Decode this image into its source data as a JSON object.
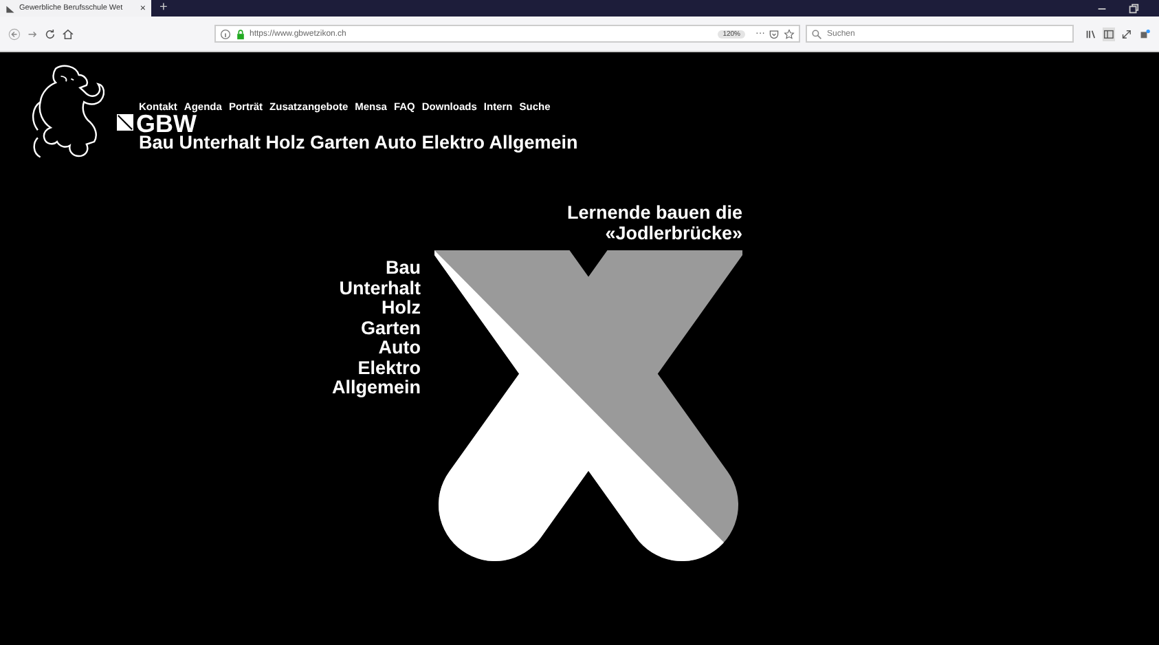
{
  "browser": {
    "tab": {
      "title": "Gewerbliche Berufsschule Wet",
      "close": "×",
      "selected": true
    },
    "new_tab": "+",
    "url": "https://www.gbwetzikon.ch",
    "zoom": "120%",
    "more": "···",
    "search": {
      "placeholder": "Suchen"
    }
  },
  "site": {
    "nav": [
      "Kontakt",
      "Agenda",
      "Porträt",
      "Zusatzangebote",
      "Mensa",
      "FAQ",
      "Downloads",
      "Intern",
      "Suche"
    ],
    "logo_text": "GBW",
    "departments_line": "Bau Unterhalt Holz Garten Auto Elektro Allgemein",
    "headline": [
      "Lernende bauen die",
      "«Jodlerbrücke»"
    ],
    "departments": [
      "Bau",
      "Unterhalt",
      "Holz",
      "Garten",
      "Auto",
      "Elektro",
      "Allgemein"
    ]
  }
}
